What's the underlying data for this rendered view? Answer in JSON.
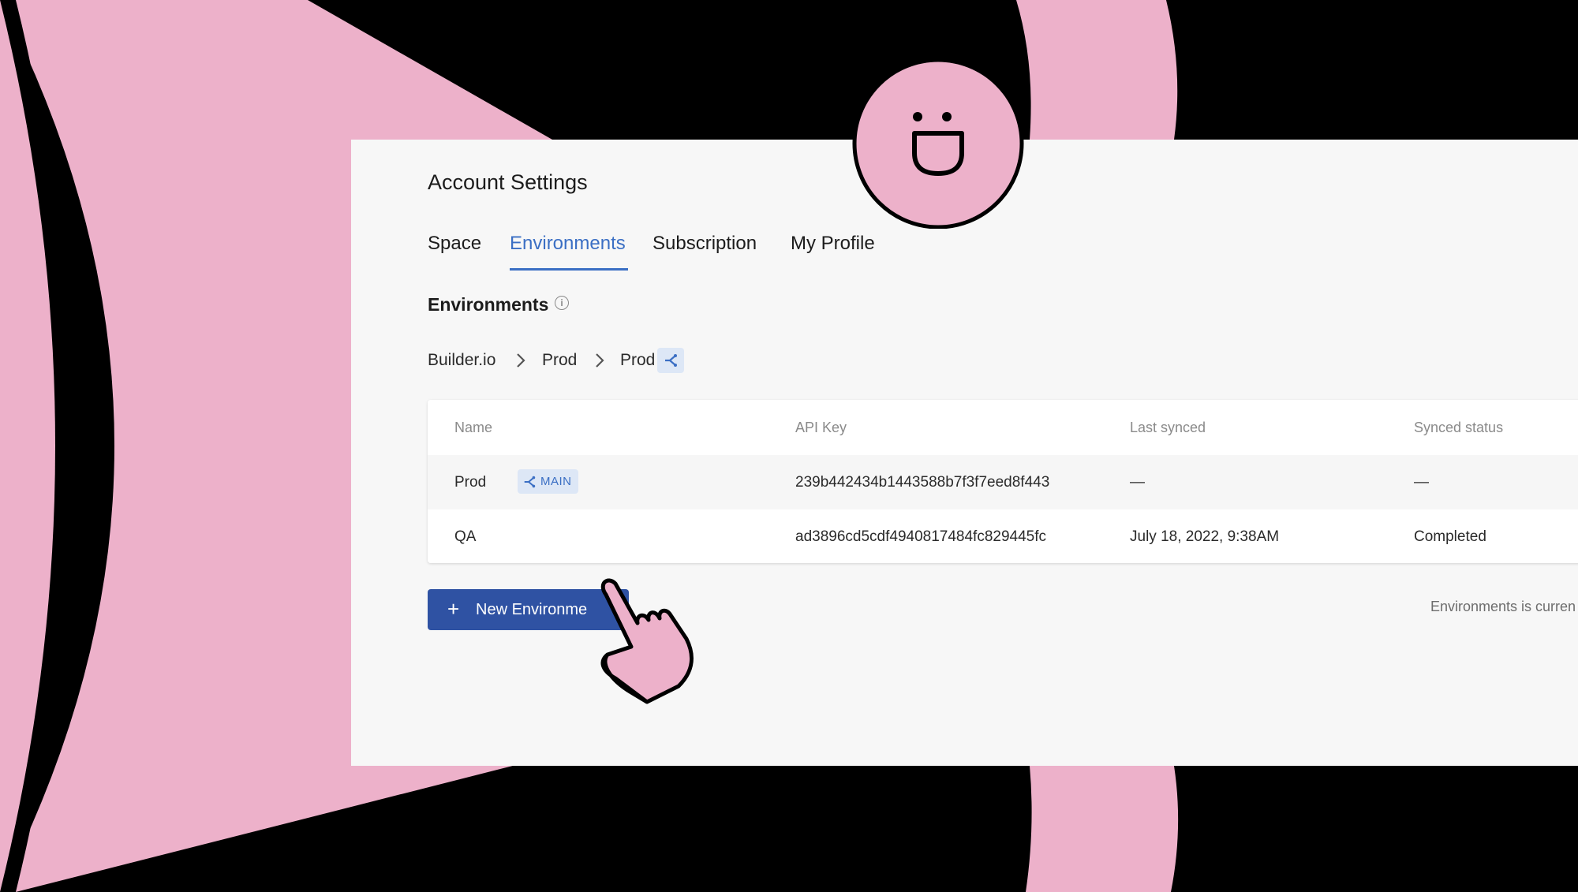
{
  "page_title": "Account Settings",
  "tabs": [
    {
      "label": "Space",
      "active": false
    },
    {
      "label": "Environments",
      "active": true
    },
    {
      "label": "Subscription",
      "active": false
    },
    {
      "label": "My Profile",
      "active": false
    }
  ],
  "section": {
    "title": "Environments",
    "info_icon": "info-icon"
  },
  "breadcrumb": [
    "Builder.io",
    "Prod",
    "Prod"
  ],
  "table": {
    "headers": [
      "Name",
      "API Key",
      "Last synced",
      "Synced status"
    ],
    "rows": [
      {
        "name": "Prod",
        "badge": "MAIN",
        "api_key": "239b442434b1443588b7f3f7eed8f443",
        "last_synced": "—",
        "status": "—"
      },
      {
        "name": "QA",
        "badge": "",
        "api_key": "ad3896cd5cdf4940817484fc829445fc",
        "last_synced": "July 18, 2022, 9:38AM",
        "status": "Completed"
      }
    ]
  },
  "new_button": {
    "label": "New Environme",
    "icon": "plus-icon"
  },
  "note": "Environments is curren",
  "colors": {
    "accent": "#3b6fc4",
    "button": "#2f52a3",
    "pink": "#edb1ca",
    "background": "#000000",
    "panel": "#f7f7f7"
  },
  "decorations": [
    "smiley-face-icon",
    "pointing-hand-cursor-icon"
  ]
}
